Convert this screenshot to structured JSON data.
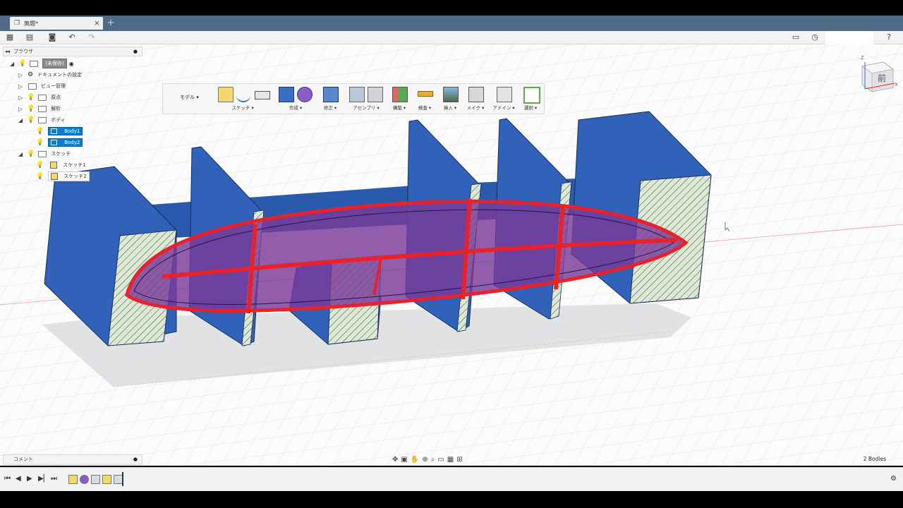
{
  "tab": {
    "title": "無題*",
    "close": "×",
    "new": "+"
  },
  "browser": {
    "header": "ブラウザ",
    "items": [
      {
        "label": "(未保存)"
      },
      {
        "label": "ドキュメントの設定"
      },
      {
        "label": "ビュー管理"
      },
      {
        "label": "原点"
      },
      {
        "label": "解析"
      },
      {
        "label": "ボディ"
      },
      {
        "label": "Body1"
      },
      {
        "label": "Body2"
      },
      {
        "label": "スケッチ"
      },
      {
        "label": "スケッチ1"
      },
      {
        "label": "スケッチ2"
      }
    ]
  },
  "ribbon": {
    "workspace": "モデル ▾",
    "groups": [
      "スケッチ ▾",
      "作成 ▾",
      "修正 ▾",
      "アセンブリ ▾",
      "構築 ▾",
      "検査 ▾",
      "挿入 ▾",
      "メイク ▾",
      "アドイン ▾",
      "選択 ▾"
    ]
  },
  "comment": {
    "label": "コメント"
  },
  "viewcube": {
    "face": "前",
    "axis_z": "Z",
    "axis_x": "X"
  },
  "status": {
    "bodies": "2 Bodies"
  },
  "colors": {
    "titlebar": "#4e6a87",
    "body_blue": "#2f62b8",
    "red": "#e8222a",
    "purple": "#6a3fa0",
    "selection": "#0a7fd1"
  },
  "icons": [
    "grid-menu-icon",
    "file-icon",
    "save-icon",
    "undo-icon",
    "redo-icon",
    "chat-icon",
    "clock-icon",
    "help-icon"
  ]
}
